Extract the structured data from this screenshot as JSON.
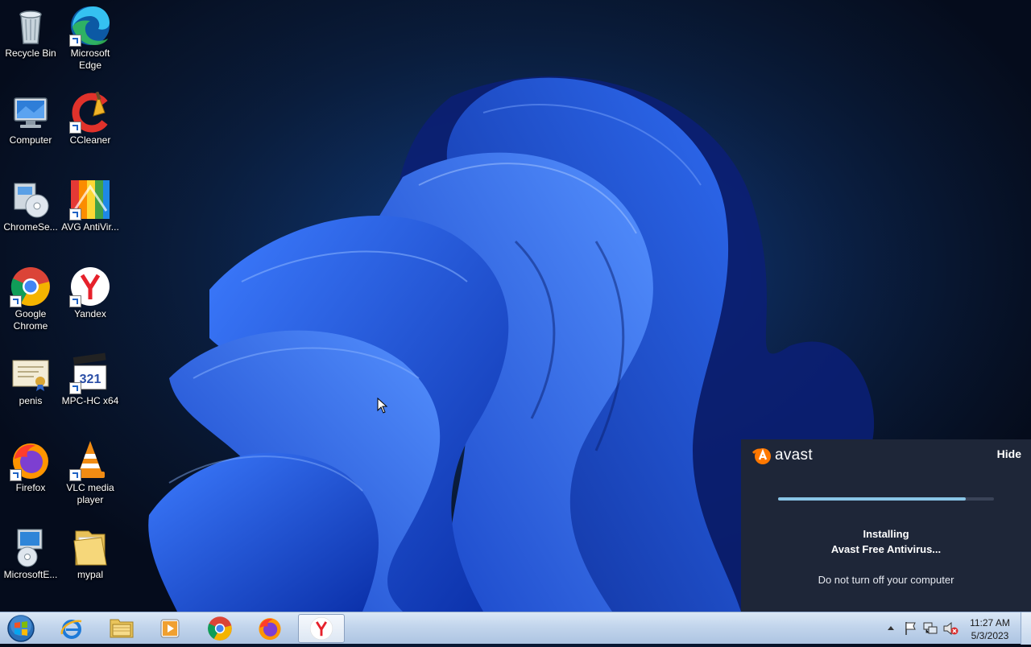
{
  "desktop": {
    "icons": [
      {
        "label": "Recycle Bin",
        "icon": "recycle-bin-icon"
      },
      {
        "label": "Microsoft Edge",
        "icon": "edge-icon"
      },
      {
        "label": "Computer",
        "icon": "computer-icon"
      },
      {
        "label": "CCleaner",
        "icon": "ccleaner-icon"
      },
      {
        "label": "ChromeSe...",
        "icon": "installer-icon"
      },
      {
        "label": "AVG AntiVir...",
        "icon": "avg-icon"
      },
      {
        "label": "Google Chrome",
        "icon": "chrome-icon"
      },
      {
        "label": "Yandex",
        "icon": "yandex-icon"
      },
      {
        "label": "penis",
        "icon": "certificate-icon"
      },
      {
        "label": "MPC-HC x64",
        "icon": "mpc-hc-icon"
      },
      {
        "label": "Firefox",
        "icon": "firefox-icon"
      },
      {
        "label": "VLC media player",
        "icon": "vlc-icon"
      },
      {
        "label": "MicrosoftE...",
        "icon": "setup-icon"
      },
      {
        "label": "mypal",
        "icon": "folder-icon"
      }
    ]
  },
  "avast": {
    "brand": "avast",
    "hide_label": "Hide",
    "progress": 0.87,
    "title_line1": "Installing",
    "title_line2": "Avast Free Antivirus...",
    "subtitle": "Do not turn off your computer",
    "colors": {
      "background": "#1e2638",
      "accent": "#ff7800",
      "progress": "#89c4e6"
    }
  },
  "taskbar": {
    "pinned": [
      "internet-explorer-icon",
      "file-explorer-icon",
      "media-player-icon",
      "chrome-icon",
      "firefox-icon",
      "yandex-icon"
    ],
    "active": "yandex-icon",
    "tray": [
      "show-hidden-icons-icon",
      "action-center-flag-icon",
      "network-icon",
      "volume-muted-icon"
    ],
    "clock": {
      "time": "11:27 AM",
      "date": "5/3/2023"
    }
  }
}
